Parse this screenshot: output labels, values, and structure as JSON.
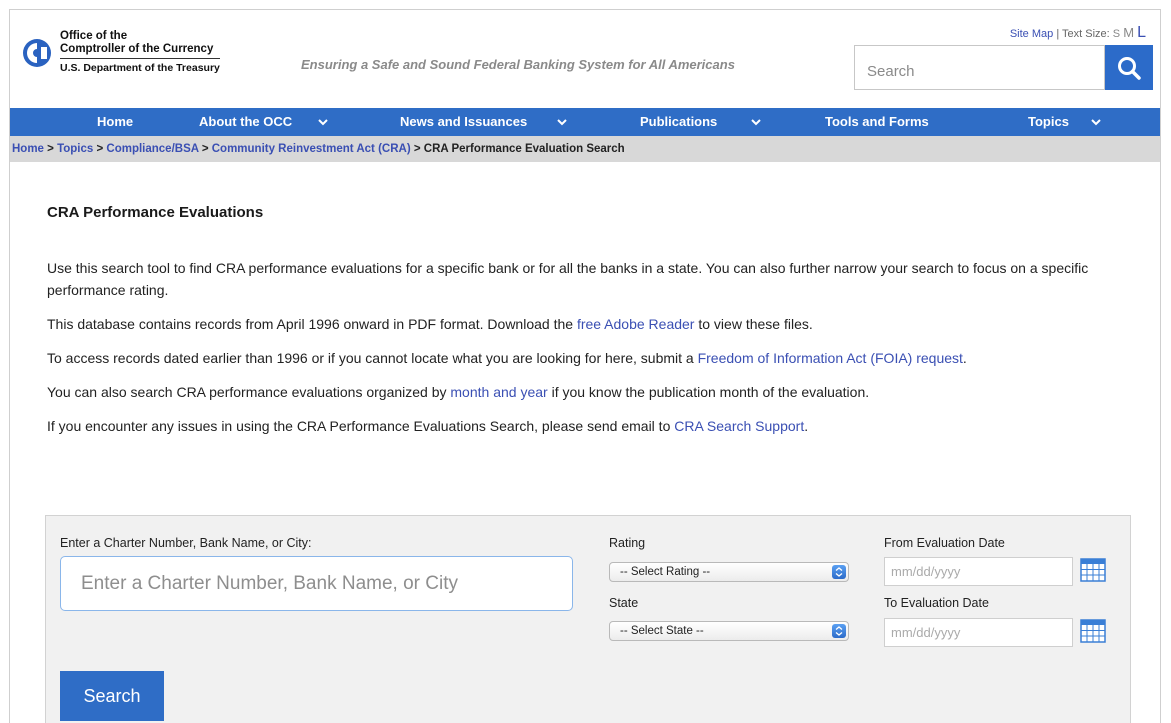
{
  "header": {
    "org_line1": "Office of the",
    "org_line2": "Comptroller of the Currency",
    "org_line3": "U.S. Department of the Treasury",
    "tagline": "Ensuring a Safe and Sound Federal Banking System for All Americans",
    "site_map": "Site Map",
    "text_size_label": "| Text Size:",
    "size_s": "S",
    "size_m": "M",
    "size_l": "L",
    "search_placeholder": "Search"
  },
  "nav": {
    "items": [
      {
        "label": "Home"
      },
      {
        "label": "About the OCC"
      },
      {
        "label": "News and Issuances"
      },
      {
        "label": "Publications"
      },
      {
        "label": "Tools and Forms"
      },
      {
        "label": "Topics"
      }
    ]
  },
  "breadcrumb": {
    "items": [
      "Home",
      "Topics",
      "Compliance/BSA",
      "Community Reinvestment Act (CRA)"
    ],
    "separator": " > ",
    "current": "CRA Performance Evaluation Search"
  },
  "main": {
    "title": "CRA Performance Evaluations",
    "p1": "Use this search tool to find CRA performance evaluations for a specific bank or for all the banks in a state. You can also further narrow your search to focus on a specific performance rating.",
    "p2_before": "This database contains records from April 1996 onward in PDF format. Download the ",
    "p2_link": "free Adobe Reader",
    "p2_after": " to view these files.",
    "p3_before": "To access records dated earlier than 1996 or if you cannot locate what you are looking for here, submit a ",
    "p3_link": "Freedom of Information Act (FOIA) request",
    "p3_after": ".",
    "p4_before": "You can also search CRA performance evaluations organized by ",
    "p4_link": "month and year",
    "p4_after": " if you know the publication month of the evaluation.",
    "p5_before": "If you encounter any issues in using the CRA Performance Evaluations Search, please send email to ",
    "p5_link": "CRA Search Support",
    "p5_after": "."
  },
  "form": {
    "query_label": "Enter a Charter Number, Bank Name, or City:",
    "query_placeholder": "Enter a Charter Number, Bank Name, or City",
    "rating_label": "Rating",
    "rating_selected": "-- Select Rating --",
    "state_label": "State",
    "state_selected": "-- Select State --",
    "from_label": "From Evaluation Date",
    "to_label": "To Evaluation Date",
    "date_placeholder": "mm/dd/yyyy",
    "submit_label": "Search"
  },
  "colors": {
    "nav_bg": "#2f6dc6",
    "link": "#3a4fb3",
    "breadcrumb_bg": "#d8d8d8",
    "panel_bg": "#f1f1f1"
  }
}
